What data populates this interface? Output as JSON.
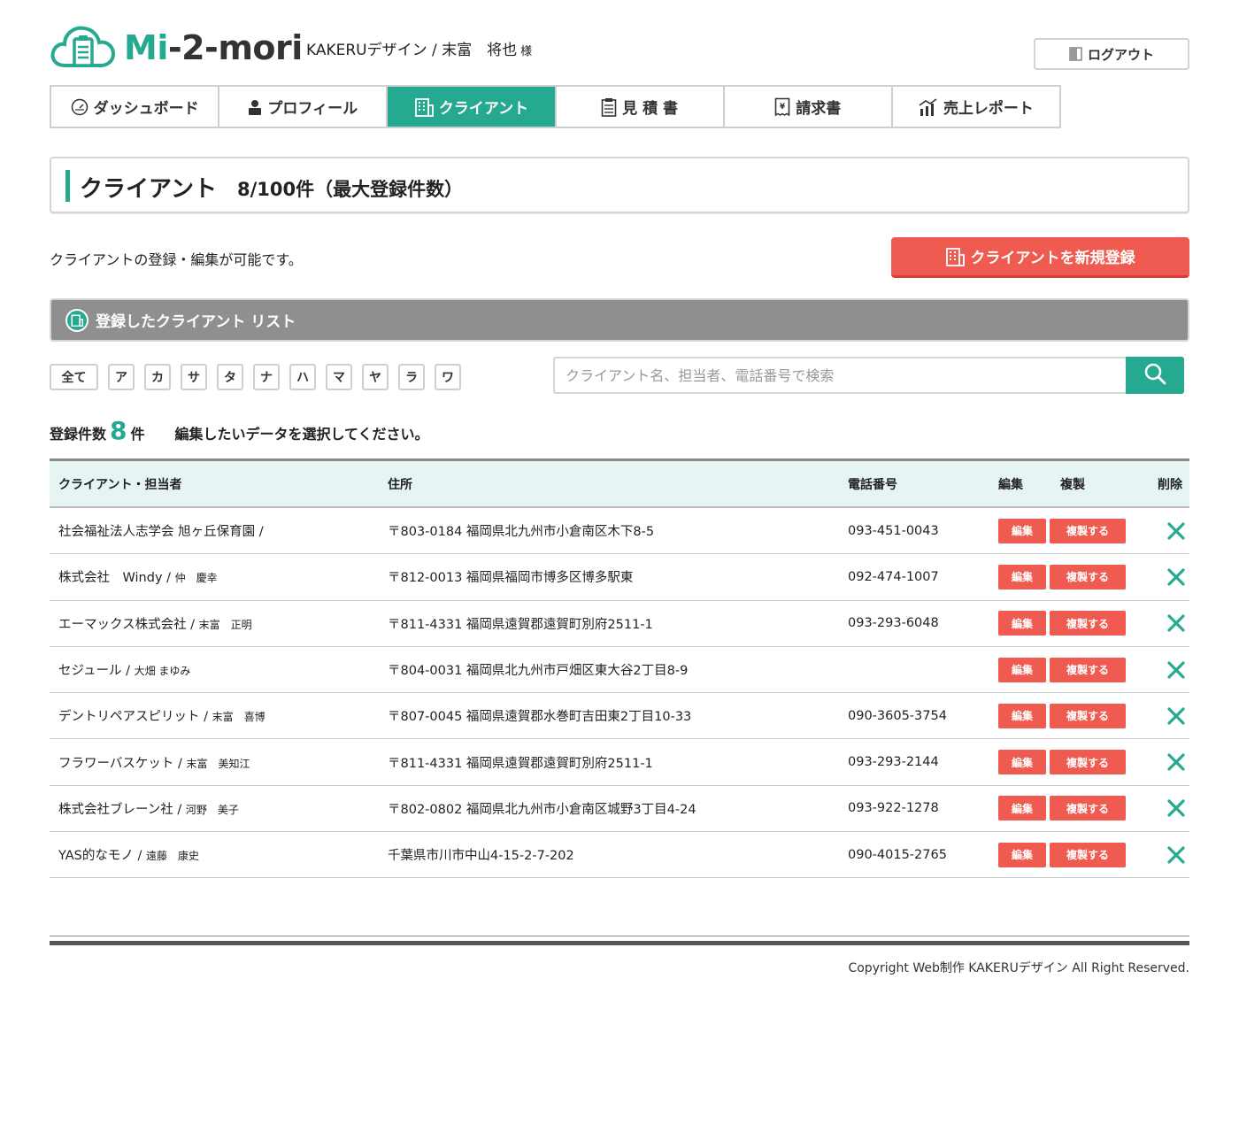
{
  "header": {
    "logo_prefix": "Mi",
    "logo_rest": "-2-mori",
    "user_name": "KAKERUデザイン / 末富　将也",
    "user_suffix": "様",
    "logout_label": "ログアウト"
  },
  "nav": {
    "tabs": [
      {
        "label": "ダッシュボード",
        "icon": "gauge-icon"
      },
      {
        "label": "プロフィール",
        "icon": "person-icon"
      },
      {
        "label": "クライアント",
        "icon": "building-icon",
        "active": true
      },
      {
        "label": "見 積 書",
        "icon": "clipboard-icon"
      },
      {
        "label": "請求書",
        "icon": "receipt-icon"
      },
      {
        "label": "売上レポート",
        "icon": "chart-icon"
      }
    ]
  },
  "page": {
    "title": "クライアント",
    "count_text": "8/100件（最大登録件数）",
    "description": "クライアントの登録・編集が可能です。",
    "new_button_label": "クライアントを新規登録",
    "list_title": "登録したクライアント リスト"
  },
  "filters": {
    "all_label": "全て",
    "kana": [
      "ア",
      "カ",
      "サ",
      "タ",
      "ナ",
      "ハ",
      "マ",
      "ヤ",
      "ラ",
      "ワ"
    ]
  },
  "search": {
    "placeholder": "クライアント名、担当者、電話番号で検索"
  },
  "summary": {
    "label": "登録件数",
    "count": "8",
    "unit": "件",
    "instruction": "編集したいデータを選択してください。"
  },
  "table": {
    "headers": {
      "client": "クライアント・担当者",
      "address": "住所",
      "phone": "電話番号",
      "edit": "編集",
      "duplicate": "複製",
      "delete": "削除"
    },
    "edit_label": "編集",
    "duplicate_label": "複製する",
    "rows": [
      {
        "client": "社会福祉法人志学会 旭ヶ丘保育園 /",
        "contact": "",
        "address": "〒803-0184 福岡県北九州市小倉南区木下8-5",
        "phone": "093-451-0043"
      },
      {
        "client": "株式会社　Windy / ",
        "contact": "仲　慶幸",
        "address": "〒812-0013 福岡県福岡市博多区博多駅東",
        "phone": "092-474-1007"
      },
      {
        "client": "エーマックス株式会社 / ",
        "contact": "末富　正明",
        "address": "〒811-4331 福岡県遠賀郡遠賀町別府2511-1",
        "phone": "093-293-6048"
      },
      {
        "client": "セジュール / ",
        "contact": "大畑 まゆみ",
        "address": "〒804-0031 福岡県北九州市戸畑区東大谷2丁目8-9",
        "phone": ""
      },
      {
        "client": "デントリペアスピリット / ",
        "contact": "末富　喜博",
        "address": "〒807-0045 福岡県遠賀郡水巻町吉田東2丁目10-33",
        "phone": "090-3605-3754"
      },
      {
        "client": "フラワーバスケット / ",
        "contact": "末富　美知江",
        "address": "〒811-4331 福岡県遠賀郡遠賀町別府2511-1",
        "phone": "093-293-2144"
      },
      {
        "client": "株式会社ブレーン社 / ",
        "contact": "河野　美子",
        "address": "〒802-0802 福岡県北九州市小倉南区城野3丁目4-24",
        "phone": "093-922-1278"
      },
      {
        "client": "YAS的なモノ / ",
        "contact": "遠藤　康史",
        "address": "千葉県市川市中山4-15-2-7-202",
        "phone": "090-4015-2765"
      }
    ]
  },
  "footer": {
    "copyright": "Copyright Web制作 KAKERUデザイン All Right Reserved."
  },
  "colors": {
    "brand": "#25a990",
    "accent_red": "#ef5b51",
    "list_bar": "#8f8f8f"
  }
}
